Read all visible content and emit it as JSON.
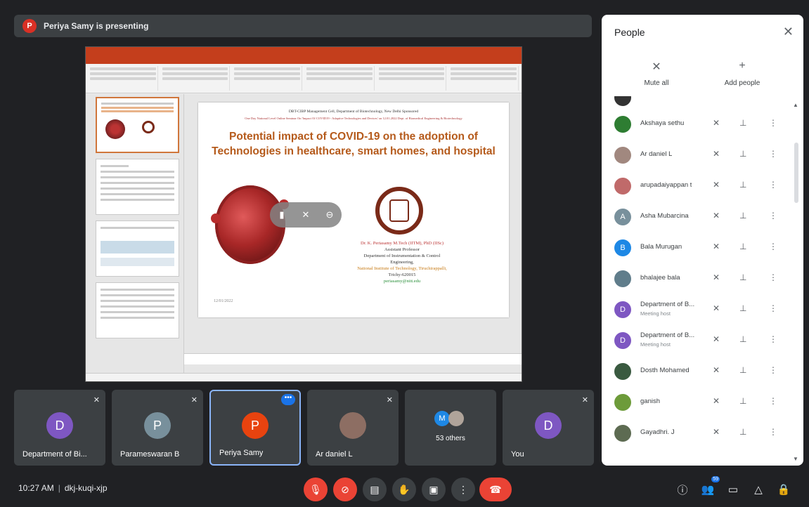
{
  "presenting": {
    "avatar_letter": "P",
    "text": "Periya Samy is presenting",
    "avatar_color": "#d93025"
  },
  "slide": {
    "header_line1": "DBT-CIBP Management Cell, Department of Biotechnology, New Delhi Sponsored",
    "header_line2": "One Day National Level Online Seminar On 'Impact Of COVID19 - Adaptive Technologies and Devices' on 12.01.2022 Dept. of Biomedical Engineering & Biotechnology",
    "title": "Potential impact of COVID-19 on the adoption of Technologies in healthcare, smart homes, and hospital",
    "author_lines": [
      "Dr. K. Periasamy M.Tech (IITM), PhD (IISc)",
      "Assistant Professor",
      "Department of Instrumentation & Control",
      "Engineering,",
      "National Institute of Technology, Tiruchirappalli,",
      "Trichy-620015",
      "periasamy@nitt.edu"
    ],
    "date": "12/01/2022"
  },
  "tiles": [
    {
      "name": "Department of Bi...",
      "letter": "D",
      "color": "#7e57c2",
      "muted": true
    },
    {
      "name": "Parameswaran B",
      "letter": "P",
      "color": "#78909c",
      "muted": true
    },
    {
      "name": "Periya Samy",
      "letter": "P",
      "color": "#e8430f",
      "muted": false,
      "active": true
    },
    {
      "name": "Ar daniel L",
      "letter": "",
      "color": "#8d6e63",
      "muted": true
    },
    {
      "name": "",
      "others_label": "53 others",
      "letter": "M",
      "color": "#1e88e5",
      "muted": false
    },
    {
      "name": "You",
      "letter": "D",
      "color": "#7e57c2",
      "muted": true
    }
  ],
  "bottom": {
    "time": "10:27 AM",
    "separator": "|",
    "meeting_code": "dkj-kuqi-xjp",
    "people_badge": "59"
  },
  "panel": {
    "title": "People",
    "mute_all": "Mute all",
    "add_people": "Add people",
    "people": [
      {
        "name": "Akshaya sethu",
        "letter": "",
        "color": "#2e7d32",
        "sub": ""
      },
      {
        "name": "Ar daniel L",
        "letter": "",
        "color": "#a1887f",
        "sub": ""
      },
      {
        "name": "arupadaiyappan t",
        "letter": "",
        "color": "#c06a6a",
        "sub": ""
      },
      {
        "name": "Asha Mubarcina",
        "letter": "A",
        "color": "#78909c",
        "sub": ""
      },
      {
        "name": "Bala Murugan",
        "letter": "B",
        "color": "#1e88e5",
        "sub": ""
      },
      {
        "name": "bhalajee bala",
        "letter": "",
        "color": "#607d8b",
        "sub": ""
      },
      {
        "name": "Department of B...",
        "letter": "D",
        "color": "#7e57c2",
        "sub": "Meeting host"
      },
      {
        "name": "Department of B...",
        "letter": "D",
        "color": "#7e57c2",
        "sub": "Meeting host"
      },
      {
        "name": "Dosth Mohamed",
        "letter": "",
        "color": "#3a5a40",
        "sub": ""
      },
      {
        "name": "ganish",
        "letter": "",
        "color": "#6d9b3a",
        "sub": ""
      },
      {
        "name": "Gayadhri. J",
        "letter": "",
        "color": "#5d6b52",
        "sub": ""
      }
    ]
  }
}
